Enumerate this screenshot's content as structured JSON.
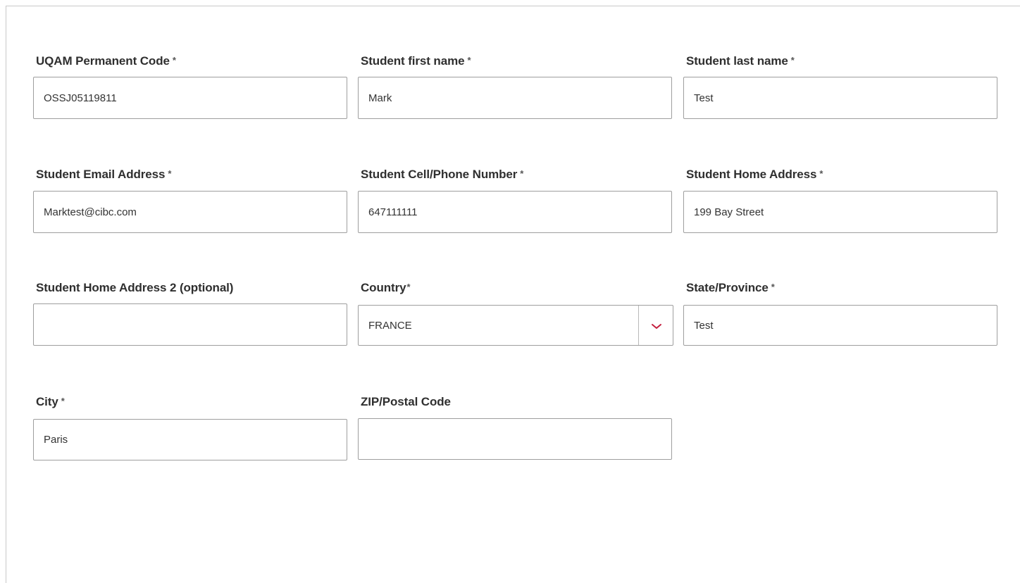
{
  "colors": {
    "border": "#9e9e9e",
    "label": "#2f2f2f",
    "chevron": "#c41f3e"
  },
  "form": {
    "permanent_code": {
      "label": "UQAM Permanent Code",
      "req": "*",
      "value": "OSSJ05119811"
    },
    "first_name": {
      "label": "Student first name",
      "req": "*",
      "value": "Mark"
    },
    "last_name": {
      "label": "Student last name",
      "req": "*",
      "value": "Test"
    },
    "email": {
      "label": "Student Email Address",
      "req": "*",
      "value": "Marktest@cibc.com"
    },
    "phone": {
      "label": "Student Cell/Phone Number",
      "req": "*",
      "value": "647111111"
    },
    "home_address": {
      "label": "Student Home Address",
      "req": "*",
      "value": "199 Bay Street"
    },
    "home_address_2": {
      "label": "Student Home Address 2 (optional)",
      "value": ""
    },
    "country": {
      "label": "Country",
      "req": "*",
      "value": "FRANCE",
      "icon": "chevron-down-icon"
    },
    "state": {
      "label": "State/Province",
      "req": "*",
      "value": "Test"
    },
    "city": {
      "label": "City",
      "req": "*",
      "value": "Paris"
    },
    "zip": {
      "label": "ZIP/Postal Code",
      "value": ""
    }
  }
}
